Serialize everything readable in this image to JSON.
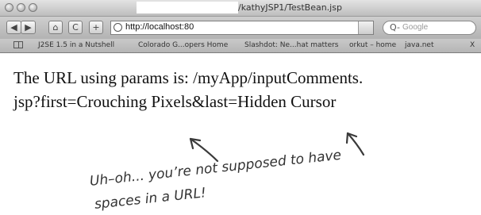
{
  "window": {
    "title": "/kathyJSP1/TestBean.jsp"
  },
  "toolbar": {
    "back_label": "◀",
    "forward_label": "▶",
    "home_label": "⌂",
    "reload_label": "C",
    "add_label": "+",
    "url_value": "http://localhost:80",
    "search_label": "Q-",
    "search_placeholder": "Google"
  },
  "bookmarks": {
    "items": [
      "J2SE 1.5 in a Nutshell",
      "Colorado G...opers Home",
      "Slashdot: Ne...hat matters",
      "orkut – home",
      "java.net",
      "X"
    ]
  },
  "page": {
    "line1": "The URL using params is: /myApp/inputComments.",
    "line2": "jsp?first=Crouching Pixels&last=Hidden Cursor"
  },
  "annotation": {
    "line1": "Uh–oh... you’re not supposed to have",
    "line2": "spaces in a URL!"
  }
}
